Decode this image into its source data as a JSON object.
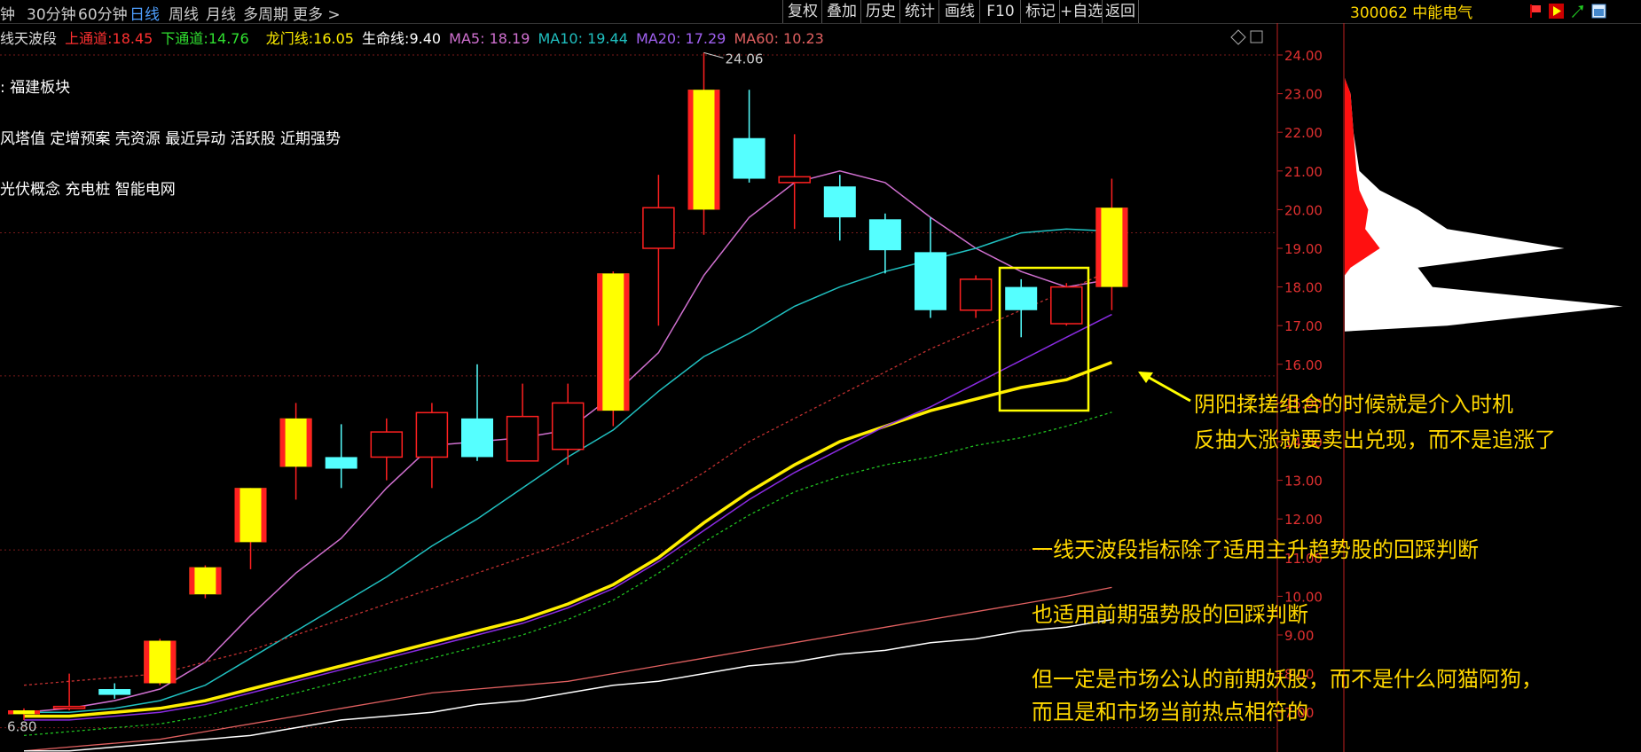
{
  "toolbar": {
    "timeframes": [
      {
        "label": "钟",
        "active": false
      },
      {
        "label": "30分钟",
        "active": false
      },
      {
        "label": "60分钟",
        "active": false
      },
      {
        "label": "日线",
        "active": true
      },
      {
        "label": "周线",
        "active": false
      },
      {
        "label": "月线",
        "active": false
      },
      {
        "label": "多周期",
        "active": false
      },
      {
        "label": "更多 >",
        "active": false
      }
    ],
    "buttons": [
      "复权",
      "叠加",
      "历史",
      "统计",
      "画线",
      "F10",
      "标记",
      "+自选",
      "返回"
    ],
    "stock": "300062 中能电气"
  },
  "indicator": {
    "name": "线天波段",
    "upper_label": "上通道:",
    "upper_value": "18.45",
    "lower_label": "下通道:",
    "lower_value": "14.76",
    "dragon_label": "龙门线:",
    "dragon_value": "16.05",
    "life_label": "生命线:",
    "life_value": "9.40",
    "ma5": "MA5: 18.19",
    "ma10": "MA10: 19.44",
    "ma20": "MA20: 17.29",
    "ma60": "MA60: 10.23"
  },
  "tags": [
    ": 福建板块",
    "风塔值 定增预案 壳资源 最近异动 活跃股 近期强势",
    "光伏概念 充电桩 智能电网"
  ],
  "annotations": [
    "阴阳揉搓组合的时候就是介入时机",
    "反抽大涨就要卖出兑现，而不是追涨了",
    "一线天波段指标除了适用主升趋势股的回踩判断",
    "也适用前期强势股的回踩判断",
    "但一定是市场公认的前期妖股，而不是什么阿猫阿狗，",
    "而且是和市场当前热点相符的"
  ],
  "colors": {
    "up": "#ff2020",
    "yang_fill": "#ffff00",
    "down": "#55ffff",
    "ma5": "#d070d0",
    "ma10": "#20c0c0",
    "dragon": "#ffee00",
    "ma20": "#8a2be2",
    "lower": "#20c020",
    "upper": "#c03030",
    "ma60": "#e06060",
    "life": "#ffffff",
    "annotation": "#ffd700"
  },
  "chart_data": {
    "type": "candlestick",
    "y_ticks": [
      "24.00",
      "23.00",
      "22.00",
      "21.00",
      "20.00",
      "19.00",
      "18.00",
      "17.00",
      "16.00",
      "15.00",
      "14.00",
      "13.00",
      "12.00",
      "11.00",
      "10.00",
      "9.00",
      "8.00",
      "7.00"
    ],
    "max_label": "24.06",
    "min_label": "6.80",
    "candles": [
      {
        "o": 6.95,
        "h": 7.1,
        "l": 6.8,
        "c": 7.05,
        "hollow": false
      },
      {
        "o": 7.1,
        "h": 8.0,
        "l": 7.05,
        "c": 7.15,
        "hollow": true
      },
      {
        "o": 7.6,
        "h": 7.75,
        "l": 7.35,
        "c": 7.45,
        "hollow": false
      },
      {
        "o": 7.75,
        "h": 8.9,
        "l": 7.7,
        "c": 8.85,
        "hollow": false
      },
      {
        "o": 10.05,
        "h": 10.8,
        "l": 9.95,
        "c": 10.75,
        "hollow": false
      },
      {
        "o": 11.4,
        "h": 12.8,
        "l": 10.7,
        "c": 12.8,
        "hollow": false
      },
      {
        "o": 13.35,
        "h": 15.0,
        "l": 12.5,
        "c": 14.6,
        "hollow": false
      },
      {
        "o": 13.6,
        "h": 14.45,
        "l": 12.8,
        "c": 13.3,
        "hollow": false
      },
      {
        "o": 13.6,
        "h": 14.6,
        "l": 13.0,
        "c": 14.25,
        "hollow": true
      },
      {
        "o": 13.6,
        "h": 15.0,
        "l": 12.8,
        "c": 14.75,
        "hollow": true
      },
      {
        "o": 14.6,
        "h": 16.0,
        "l": 13.5,
        "c": 13.6,
        "hollow": false
      },
      {
        "o": 13.5,
        "h": 15.5,
        "l": 13.5,
        "c": 14.65,
        "hollow": true
      },
      {
        "o": 13.8,
        "h": 15.5,
        "l": 13.4,
        "c": 15.0,
        "hollow": true
      },
      {
        "o": 14.8,
        "h": 18.4,
        "l": 14.4,
        "c": 18.35,
        "hollow": false
      },
      {
        "o": 19.0,
        "h": 20.9,
        "l": 17.0,
        "c": 20.05,
        "hollow": true
      },
      {
        "o": 20.0,
        "h": 24.06,
        "l": 19.35,
        "c": 23.1,
        "hollow": false
      },
      {
        "o": 21.85,
        "h": 23.1,
        "l": 20.7,
        "c": 20.8,
        "hollow": false
      },
      {
        "o": 20.7,
        "h": 21.95,
        "l": 19.5,
        "c": 20.85,
        "hollow": true
      },
      {
        "o": 20.6,
        "h": 20.9,
        "l": 19.2,
        "c": 19.8,
        "hollow": false
      },
      {
        "o": 19.75,
        "h": 19.9,
        "l": 18.35,
        "c": 18.95,
        "hollow": false
      },
      {
        "o": 18.9,
        "h": 19.8,
        "l": 17.2,
        "c": 17.4,
        "hollow": false
      },
      {
        "o": 17.4,
        "h": 18.3,
        "l": 17.2,
        "c": 18.2,
        "hollow": true
      },
      {
        "o": 18.0,
        "h": 18.2,
        "l": 16.7,
        "c": 17.4,
        "hollow": false
      },
      {
        "o": 17.05,
        "h": 18.1,
        "l": 17.0,
        "c": 18.0,
        "hollow": true
      },
      {
        "o": 18.0,
        "h": 20.8,
        "l": 17.4,
        "c": 20.05,
        "hollow": false
      }
    ],
    "series": [
      {
        "name": "MA5",
        "values": [
          7.0,
          7.1,
          7.3,
          7.6,
          8.3,
          9.5,
          10.6,
          11.5,
          12.8,
          13.9,
          14.0,
          14.1,
          14.3,
          15.2,
          16.3,
          18.3,
          19.8,
          20.7,
          21.0,
          20.7,
          19.8,
          19.0,
          18.4,
          18.0,
          18.2
        ]
      },
      {
        "name": "MA10",
        "values": [
          7.0,
          7.0,
          7.1,
          7.3,
          7.7,
          8.4,
          9.1,
          9.8,
          10.5,
          11.3,
          12.0,
          12.8,
          13.6,
          14.3,
          15.3,
          16.2,
          16.8,
          17.5,
          18.0,
          18.4,
          18.7,
          19.0,
          19.4,
          19.5,
          19.44
        ]
      },
      {
        "name": "龙门线",
        "values": [
          6.9,
          6.9,
          7.0,
          7.1,
          7.3,
          7.6,
          7.9,
          8.2,
          8.5,
          8.8,
          9.1,
          9.4,
          9.8,
          10.3,
          11.0,
          11.9,
          12.7,
          13.4,
          14.0,
          14.4,
          14.8,
          15.1,
          15.4,
          15.6,
          16.05
        ]
      },
      {
        "name": "MA20",
        "values": [
          6.8,
          6.8,
          6.9,
          7.0,
          7.2,
          7.5,
          7.8,
          8.1,
          8.4,
          8.7,
          9.0,
          9.3,
          9.7,
          10.2,
          10.9,
          11.7,
          12.5,
          13.2,
          13.8,
          14.4,
          14.9,
          15.5,
          16.1,
          16.7,
          17.29
        ]
      },
      {
        "name": "下通道",
        "values": [
          6.4,
          6.5,
          6.6,
          6.7,
          6.9,
          7.2,
          7.5,
          7.8,
          8.1,
          8.4,
          8.7,
          9.0,
          9.4,
          9.9,
          10.6,
          11.4,
          12.1,
          12.7,
          13.1,
          13.4,
          13.6,
          13.9,
          14.1,
          14.4,
          14.76
        ]
      },
      {
        "name": "上通道",
        "values": [
          7.7,
          7.8,
          7.9,
          8.0,
          8.3,
          8.6,
          9.0,
          9.4,
          9.8,
          10.2,
          10.6,
          11.0,
          11.4,
          11.9,
          12.5,
          13.2,
          14.0,
          14.6,
          15.2,
          15.8,
          16.4,
          16.9,
          17.4,
          17.9,
          18.45
        ]
      },
      {
        "name": "MA60",
        "values": [
          6.0,
          6.1,
          6.2,
          6.3,
          6.5,
          6.7,
          6.9,
          7.1,
          7.3,
          7.5,
          7.6,
          7.7,
          7.8,
          8.0,
          8.2,
          8.4,
          8.6,
          8.8,
          9.0,
          9.2,
          9.4,
          9.6,
          9.8,
          10.0,
          10.23
        ]
      },
      {
        "name": "生命线",
        "values": [
          6.0,
          6.0,
          6.1,
          6.2,
          6.3,
          6.4,
          6.6,
          6.8,
          6.9,
          7.0,
          7.2,
          7.3,
          7.5,
          7.7,
          7.8,
          8.0,
          8.2,
          8.3,
          8.5,
          8.6,
          8.8,
          8.9,
          9.1,
          9.2,
          9.4
        ]
      }
    ],
    "volume_profile": {
      "prices": [
        17.0,
        17.5,
        18.0,
        18.5,
        19.0,
        19.5,
        20.0,
        20.5,
        21.0,
        22.0,
        23.0
      ],
      "total": [
        0.35,
        0.95,
        0.3,
        0.25,
        0.75,
        0.35,
        0.25,
        0.12,
        0.05,
        0.03,
        0.02
      ],
      "red": [
        0.0,
        0.0,
        0.0,
        0.02,
        0.12,
        0.07,
        0.08,
        0.05,
        0.04,
        0.03,
        0.02
      ]
    }
  }
}
